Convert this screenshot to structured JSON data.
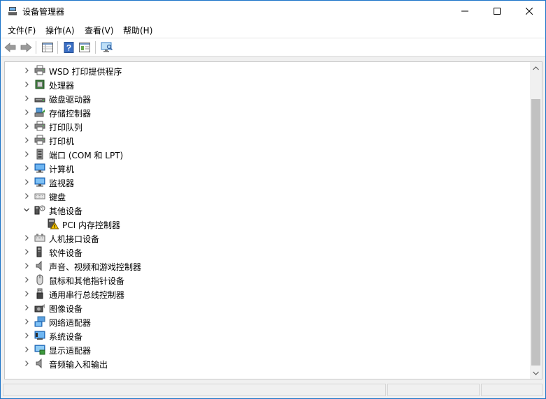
{
  "window": {
    "title": "设备管理器",
    "accent": "#1a73c8"
  },
  "menu": {
    "items": [
      "文件(F)",
      "操作(A)",
      "查看(V)",
      "帮助(H)"
    ]
  },
  "toolbar": {
    "buttons": [
      "back-icon",
      "forward-icon",
      "properties-grid-icon",
      "help-icon",
      "view-icon",
      "scan-monitor-icon"
    ]
  },
  "tree": {
    "items": [
      {
        "label": "WSD 打印提供程序",
        "icon": "printer-icon",
        "expanded": false,
        "level": 0
      },
      {
        "label": "处理器",
        "icon": "processor-icon",
        "expanded": false,
        "level": 0
      },
      {
        "label": "磁盘驱动器",
        "icon": "disk-drive-icon",
        "expanded": false,
        "level": 0
      },
      {
        "label": "存储控制器",
        "icon": "storage-controller-icon",
        "expanded": false,
        "level": 0
      },
      {
        "label": "打印队列",
        "icon": "print-queue-icon",
        "expanded": false,
        "level": 0
      },
      {
        "label": "打印机",
        "icon": "printer-icon",
        "expanded": false,
        "level": 0
      },
      {
        "label": "端口 (COM 和 LPT)",
        "icon": "port-icon",
        "expanded": false,
        "level": 0
      },
      {
        "label": "计算机",
        "icon": "computer-icon",
        "expanded": false,
        "level": 0
      },
      {
        "label": "监视器",
        "icon": "monitor-icon",
        "expanded": false,
        "level": 0
      },
      {
        "label": "键盘",
        "icon": "keyboard-icon",
        "expanded": false,
        "level": 0
      },
      {
        "label": "其他设备",
        "icon": "other-devices-icon",
        "expanded": true,
        "level": 0
      },
      {
        "label": "PCI 内存控制器",
        "icon": "warning-device-icon",
        "expanded": null,
        "level": 1
      },
      {
        "label": "人机接口设备",
        "icon": "hid-icon",
        "expanded": false,
        "level": 0
      },
      {
        "label": "软件设备",
        "icon": "software-device-icon",
        "expanded": false,
        "level": 0
      },
      {
        "label": "声音、视频和游戏控制器",
        "icon": "speaker-icon",
        "expanded": false,
        "level": 0
      },
      {
        "label": "鼠标和其他指针设备",
        "icon": "mouse-icon",
        "expanded": false,
        "level": 0
      },
      {
        "label": "通用串行总线控制器",
        "icon": "usb-icon",
        "expanded": false,
        "level": 0
      },
      {
        "label": "图像设备",
        "icon": "camera-icon",
        "expanded": false,
        "level": 0
      },
      {
        "label": "网络适配器",
        "icon": "network-adapter-icon",
        "expanded": false,
        "level": 0
      },
      {
        "label": "系统设备",
        "icon": "system-device-icon",
        "expanded": false,
        "level": 0
      },
      {
        "label": "显示适配器",
        "icon": "display-adapter-icon",
        "expanded": false,
        "level": 0
      },
      {
        "label": "音频输入和输出",
        "icon": "audio-io-icon",
        "expanded": false,
        "level": 0
      }
    ]
  }
}
